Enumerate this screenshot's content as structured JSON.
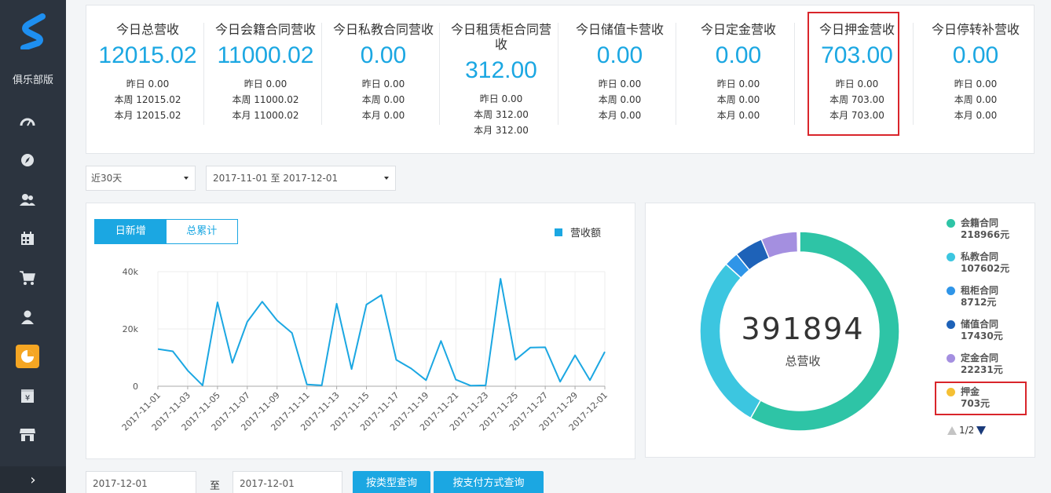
{
  "sidebar": {
    "club_label": "俱乐部版",
    "items": [
      {
        "icon": "dashboard-gauge-icon"
      },
      {
        "icon": "compass-icon"
      },
      {
        "icon": "users-icon"
      },
      {
        "icon": "calendar-icon"
      },
      {
        "icon": "cart-icon"
      },
      {
        "icon": "member-icon"
      },
      {
        "icon": "pie-chart-icon"
      },
      {
        "icon": "yuan-finance-icon"
      },
      {
        "icon": "store-icon"
      }
    ],
    "active_index": 6,
    "collapse_glyph": "›"
  },
  "stats": [
    {
      "label": "今日总营收",
      "value": "12015.02",
      "yesterday": "昨日 0.00",
      "week": "本周 12015.02",
      "month": "本月 12015.02"
    },
    {
      "label": "今日会籍合同营收",
      "value": "11000.02",
      "yesterday": "昨日 0.00",
      "week": "本周 11000.02",
      "month": "本月 11000.02"
    },
    {
      "label": "今日私教合同营收",
      "value": "0.00",
      "yesterday": "昨日 0.00",
      "week": "本周 0.00",
      "month": "本月 0.00"
    },
    {
      "label": "今日租赁柜合同营收",
      "value": "312.00",
      "yesterday": "昨日 0.00",
      "week": "本周 312.00",
      "month": "本月 312.00"
    },
    {
      "label": "今日储值卡营收",
      "value": "0.00",
      "yesterday": "昨日 0.00",
      "week": "本周 0.00",
      "month": "本月 0.00"
    },
    {
      "label": "今日定金营收",
      "value": "0.00",
      "yesterday": "昨日 0.00",
      "week": "本周 0.00",
      "month": "本月 0.00"
    },
    {
      "label": "今日押金营收",
      "value": "703.00",
      "yesterday": "昨日 0.00",
      "week": "本周 703.00",
      "month": "本月 703.00"
    },
    {
      "label": "今日停转补营收",
      "value": "0.00",
      "yesterday": "昨日 0.00",
      "week": "本周 0.00",
      "month": "本月 0.00"
    }
  ],
  "filters": {
    "period": "近30天",
    "range": "2017-11-01 至 2017-12-01"
  },
  "line_chart": {
    "tabs": [
      "日新增",
      "总累计"
    ],
    "active_tab": 0,
    "legend": "营收额"
  },
  "chart_data": [
    {
      "type": "line",
      "title": "",
      "xlabel": "",
      "ylabel": "",
      "ylim": [
        0,
        40000
      ],
      "yticks": [
        {
          "value": 0,
          "label": "0"
        },
        {
          "value": 20000,
          "label": "20k"
        },
        {
          "value": 40000,
          "label": "40k"
        }
      ],
      "grid": true,
      "legend_position": "top-right",
      "x": [
        "2017-11-01",
        "2017-11-02",
        "2017-11-03",
        "2017-11-04",
        "2017-11-05",
        "2017-11-06",
        "2017-11-07",
        "2017-11-08",
        "2017-11-09",
        "2017-11-10",
        "2017-11-11",
        "2017-11-12",
        "2017-11-13",
        "2017-11-14",
        "2017-11-15",
        "2017-11-16",
        "2017-11-17",
        "2017-11-18",
        "2017-11-19",
        "2017-11-20",
        "2017-11-21",
        "2017-11-22",
        "2017-11-23",
        "2017-11-24",
        "2017-11-25",
        "2017-11-26",
        "2017-11-27",
        "2017-11-28",
        "2017-11-29",
        "2017-11-30",
        "2017-12-01"
      ],
      "x_tick_labels": [
        "2017-11-01",
        "2017-11-03",
        "2017-11-05",
        "2017-11-07",
        "2017-11-09",
        "2017-11-11",
        "2017-11-13",
        "2017-11-15",
        "2017-11-17",
        "2017-11-19",
        "2017-11-21",
        "2017-11-23",
        "2017-11-25",
        "2017-11-27",
        "2017-11-29",
        "2017-12-01"
      ],
      "series": [
        {
          "name": "营收额",
          "color": "#1ba7e2",
          "values": [
            13000,
            12200,
            5500,
            300,
            29300,
            8200,
            22500,
            29500,
            23000,
            18600,
            600,
            300,
            28800,
            6000,
            28500,
            31800,
            9200,
            6200,
            2100,
            15800,
            2300,
            200,
            300,
            37500,
            9200,
            13500,
            13600,
            1600,
            10800,
            2100,
            12015
          ]
        }
      ]
    },
    {
      "type": "pie",
      "donut": true,
      "title": "",
      "total": "391894",
      "total_label": "总营收",
      "slices": [
        {
          "name": "会籍合同",
          "value": 218966,
          "label": "218966元",
          "color": "#2ec4a6"
        },
        {
          "name": "私教合同",
          "value": 107602,
          "label": "107602元",
          "color": "#3cc6e0"
        },
        {
          "name": "租柜合同",
          "value": 8712,
          "label": "8712元",
          "color": "#2f95e8"
        },
        {
          "name": "储值合同",
          "value": 17430,
          "label": "17430元",
          "color": "#1e62b8"
        },
        {
          "name": "定金合同",
          "value": 22231,
          "label": "22231元",
          "color": "#a48fe0"
        },
        {
          "name": "押金",
          "value": 703,
          "label": "703元",
          "color": "#f5c034"
        },
        {
          "name": "",
          "value": 700,
          "label": "",
          "color": "#e05a5a"
        }
      ],
      "legend_position": "right",
      "pager": "1/2"
    }
  ],
  "bottom": {
    "date_from": "2017-12-01",
    "to_label": "至",
    "date_to": "2017-12-01",
    "btn_type": "按类型查询",
    "btn_pay": "按支付方式查询"
  }
}
